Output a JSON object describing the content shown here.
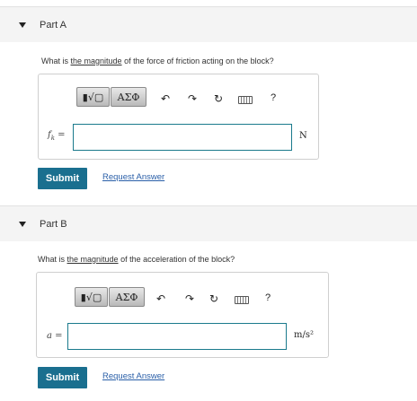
{
  "parts": [
    {
      "title": "Part A",
      "question_pre": "What is ",
      "question_link": "the magnitude",
      "question_post": " of the force of friction acting on the block?",
      "variable_symbol": "f",
      "variable_sub": "k",
      "variable_eq": " =",
      "input_value": "",
      "unit": "N",
      "submit_label": "Submit",
      "request_label": "Request Answer"
    },
    {
      "title": "Part B",
      "question_pre": "What is ",
      "question_link": "the magnitude",
      "question_post": " of the acceleration of the block?",
      "variable_symbol": "a",
      "variable_eq": " =",
      "input_value": "",
      "unit": "m/s²",
      "submit_label": "Submit",
      "request_label": "Request Answer"
    }
  ],
  "toolbar": {
    "templates_glyph": "▮√▢",
    "greek_glyph": "ΑΣΦ",
    "undo_glyph": "↶",
    "redo_glyph": "↷",
    "reset_glyph": "↻",
    "help_glyph": "?"
  },
  "icons": [
    "caret-down-icon",
    "templates-icon",
    "greek-symbols-icon",
    "undo-icon",
    "redo-icon",
    "reset-icon",
    "keyboard-icon",
    "help-icon"
  ]
}
